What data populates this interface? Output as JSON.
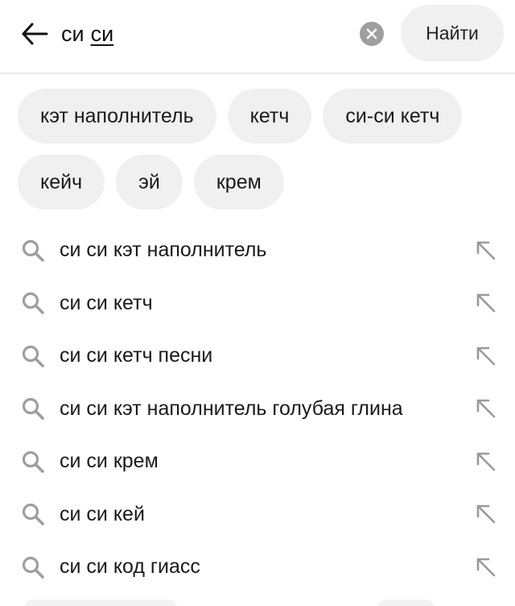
{
  "search": {
    "query_typed": "си",
    "query_completed": "си",
    "find_label": "Найти"
  },
  "chips": [
    "кэт наполнитель",
    "кетч",
    "си-си кетч",
    "кейч",
    "эй",
    "крем"
  ],
  "suggestions": [
    "си си кэт наполнитель",
    "си си кетч",
    "си си кетч песни",
    "си си кэт наполнитель голубая глина",
    "си си крем",
    "си си кей",
    "си си код гиасс"
  ],
  "icons": {
    "back": "arrow-left-icon",
    "clear": "clear-x-icon",
    "suggestion": "search-icon",
    "fill": "arrow-up-left-icon"
  },
  "colors": {
    "chip_bg": "#f0f0f0",
    "icon_gray": "#9e9e9e",
    "text": "#1a1a1a"
  }
}
